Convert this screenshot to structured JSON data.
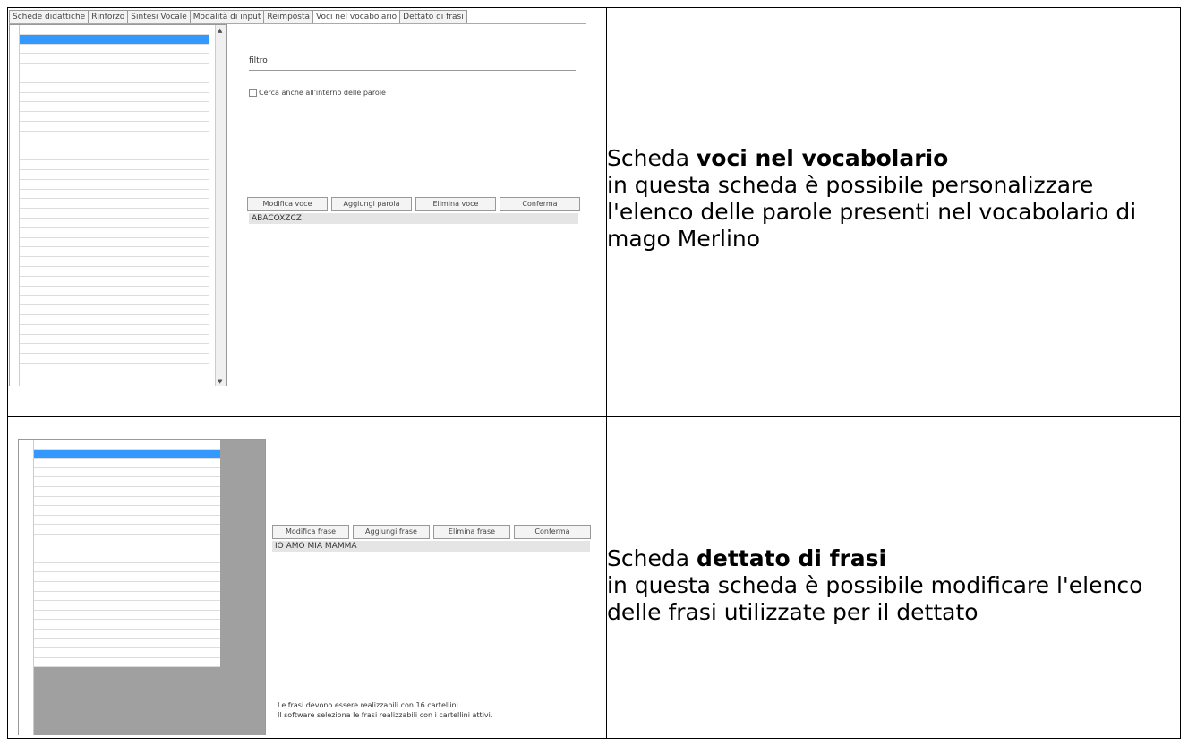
{
  "rows": [
    {
      "description": {
        "prefix": "Scheda ",
        "bold": "voci nel vocabolario",
        "body": "in questa scheda è possibile personalizzare l'elenco delle parole presenti nel vocabolario di mago Merlino"
      },
      "screenshot": {
        "tabs": [
          "Schede didattiche",
          "Rinforzo",
          "Sintesi Vocale",
          "Modalità di input",
          "Reimposta",
          "Voci nel vocabolario",
          "Dettato di frasi"
        ],
        "active_tab": "Voci nel vocabolario",
        "filter_label": "filtro",
        "checkbox_label": "Cerca anche all'interno delle parole",
        "buttons": [
          "Modifica voce",
          "Aggiungi parola",
          "Elimina voce",
          "Conferma"
        ],
        "current_value": "ABACOXZCZ"
      }
    },
    {
      "description": {
        "prefix": "Scheda ",
        "bold": "dettato di frasi",
        "body": "in questa scheda è possibile modificare l'elenco delle frasi utilizzate per il dettato"
      },
      "screenshot": {
        "buttons": [
          "Modifica frase",
          "Aggiungi frase",
          "Elimina frase",
          "Conferma"
        ],
        "current_value": "IO AMO MIA MAMMA",
        "note": [
          "Le frasi devono essere realizzabili con 16 cartellini.",
          "Il software seleziona le frasi realizzabili con i cartellini attivi."
        ]
      }
    }
  ]
}
